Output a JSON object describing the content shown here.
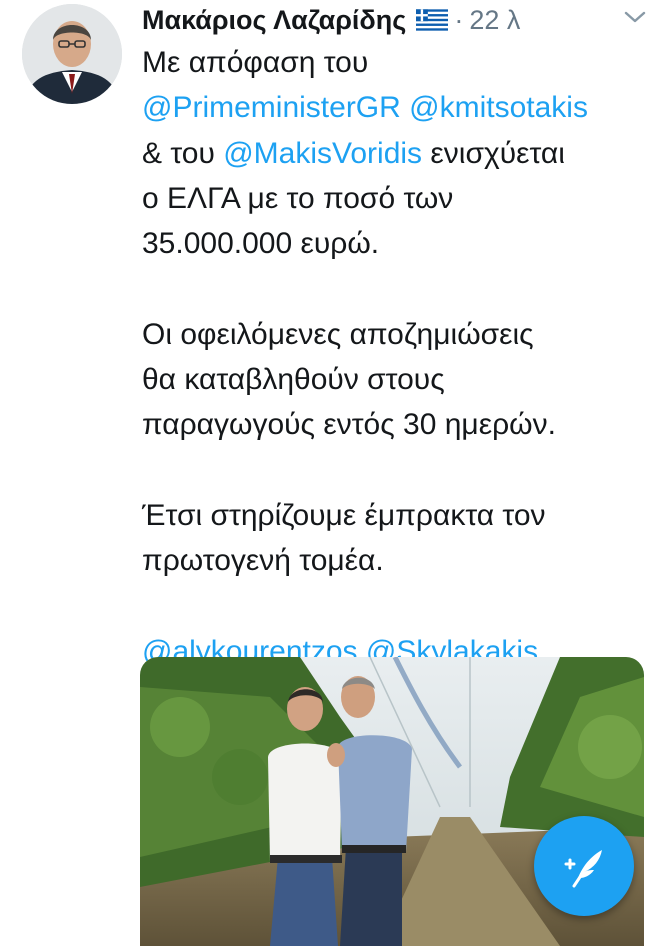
{
  "tweet": {
    "author_name": "Μακάριος Λαζαρίδης",
    "separator": "·",
    "time": "22 λ",
    "flag_icon": "greek-flag-icon",
    "menu_icon": "chevron-down-icon",
    "paragraph1": {
      "l1": "Με απόφαση του",
      "l2_m1": "@PrimeministerGR",
      "l2_m2": "@kmitsotakis",
      "l3_pre": "& του",
      "l3_m": "@MakisVoridis",
      "l3_post": "ενισχύεται",
      "l4": "ο ΕΛΓΑ με το ποσό των",
      "l5": "35.000.000 ευρώ."
    },
    "paragraph2": {
      "l1": "Οι οφειλόμενες αποζημιώσεις",
      "l2": "θα καταβληθούν στους",
      "l3": "παραγωγούς εντός 30 ημερών."
    },
    "paragraph3": {
      "l1": "Έτσι στηρίζουμε έμπρακτα τον",
      "l2": "πρωτογενή τομέα."
    },
    "mentions_line": {
      "m1": "@alykourentzos",
      "m2": "@Skylakakis"
    }
  },
  "compose_button": {
    "icon": "compose-feather-icon"
  },
  "colors": {
    "link": "#1da1f2",
    "text": "#14171a",
    "meta": "#657786",
    "fab": "#1da1f2"
  }
}
